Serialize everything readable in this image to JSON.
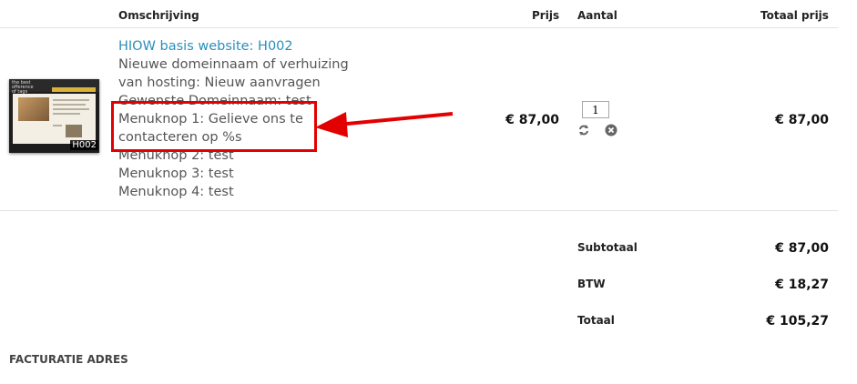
{
  "table": {
    "headers": {
      "description": "Omschrijving",
      "price": "Prijs",
      "quantity": "Aantal",
      "total": "Totaal prijs"
    }
  },
  "item": {
    "thumbnail_code": "H002",
    "thumbnail_logo": "the best ofference of tags",
    "title": "HIOW basis website: H002",
    "lines": [
      "Nieuwe domeinnaam of verhuizing",
      "van hosting: Nieuw aanvragen",
      "Gewenste Domeinnaam: test",
      "Menuknop 1: Gelieve ons te",
      "contacteren op %s",
      "Menuknop 2: test",
      "Menuknop 3: test",
      "Menuknop 4: test"
    ],
    "price": "€ 87,00",
    "quantity": "1",
    "total": "€ 87,00"
  },
  "icons": {
    "refresh": "refresh-icon",
    "remove": "remove-icon"
  },
  "totals": {
    "subtotal_label": "Subtotaal",
    "subtotal_value": "€ 87,00",
    "vat_label": "BTW",
    "vat_value": "€ 18,27",
    "total_label": "Totaal",
    "total_value": "€ 105,27"
  },
  "billing_heading": "FACTURATIE ADRES",
  "colors": {
    "link": "#2a8fbd",
    "annotation": "#e30000"
  }
}
